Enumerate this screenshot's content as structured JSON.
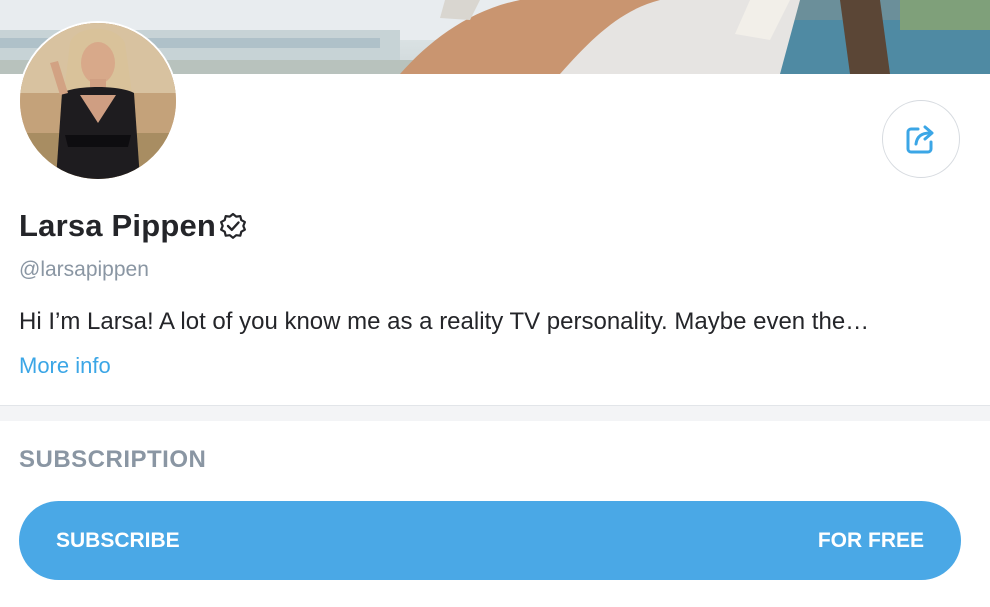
{
  "profile": {
    "name": "Larsa Pippen",
    "handle": "@larsapippen",
    "bio": "Hi I’m Larsa! A lot of you know me as a reality TV personality. Maybe even the…",
    "more_info_label": "More info"
  },
  "subscription": {
    "section_title": "SUBSCRIPTION",
    "button_label": "SUBSCRIBE",
    "price_label": "FOR FREE"
  },
  "icons": {
    "share": "share-icon",
    "verified": "verified-badge-icon"
  },
  "colors": {
    "accent": "#4aa8e6",
    "link": "#3ba6e6",
    "muted": "#8a96a3",
    "text": "#242529"
  }
}
